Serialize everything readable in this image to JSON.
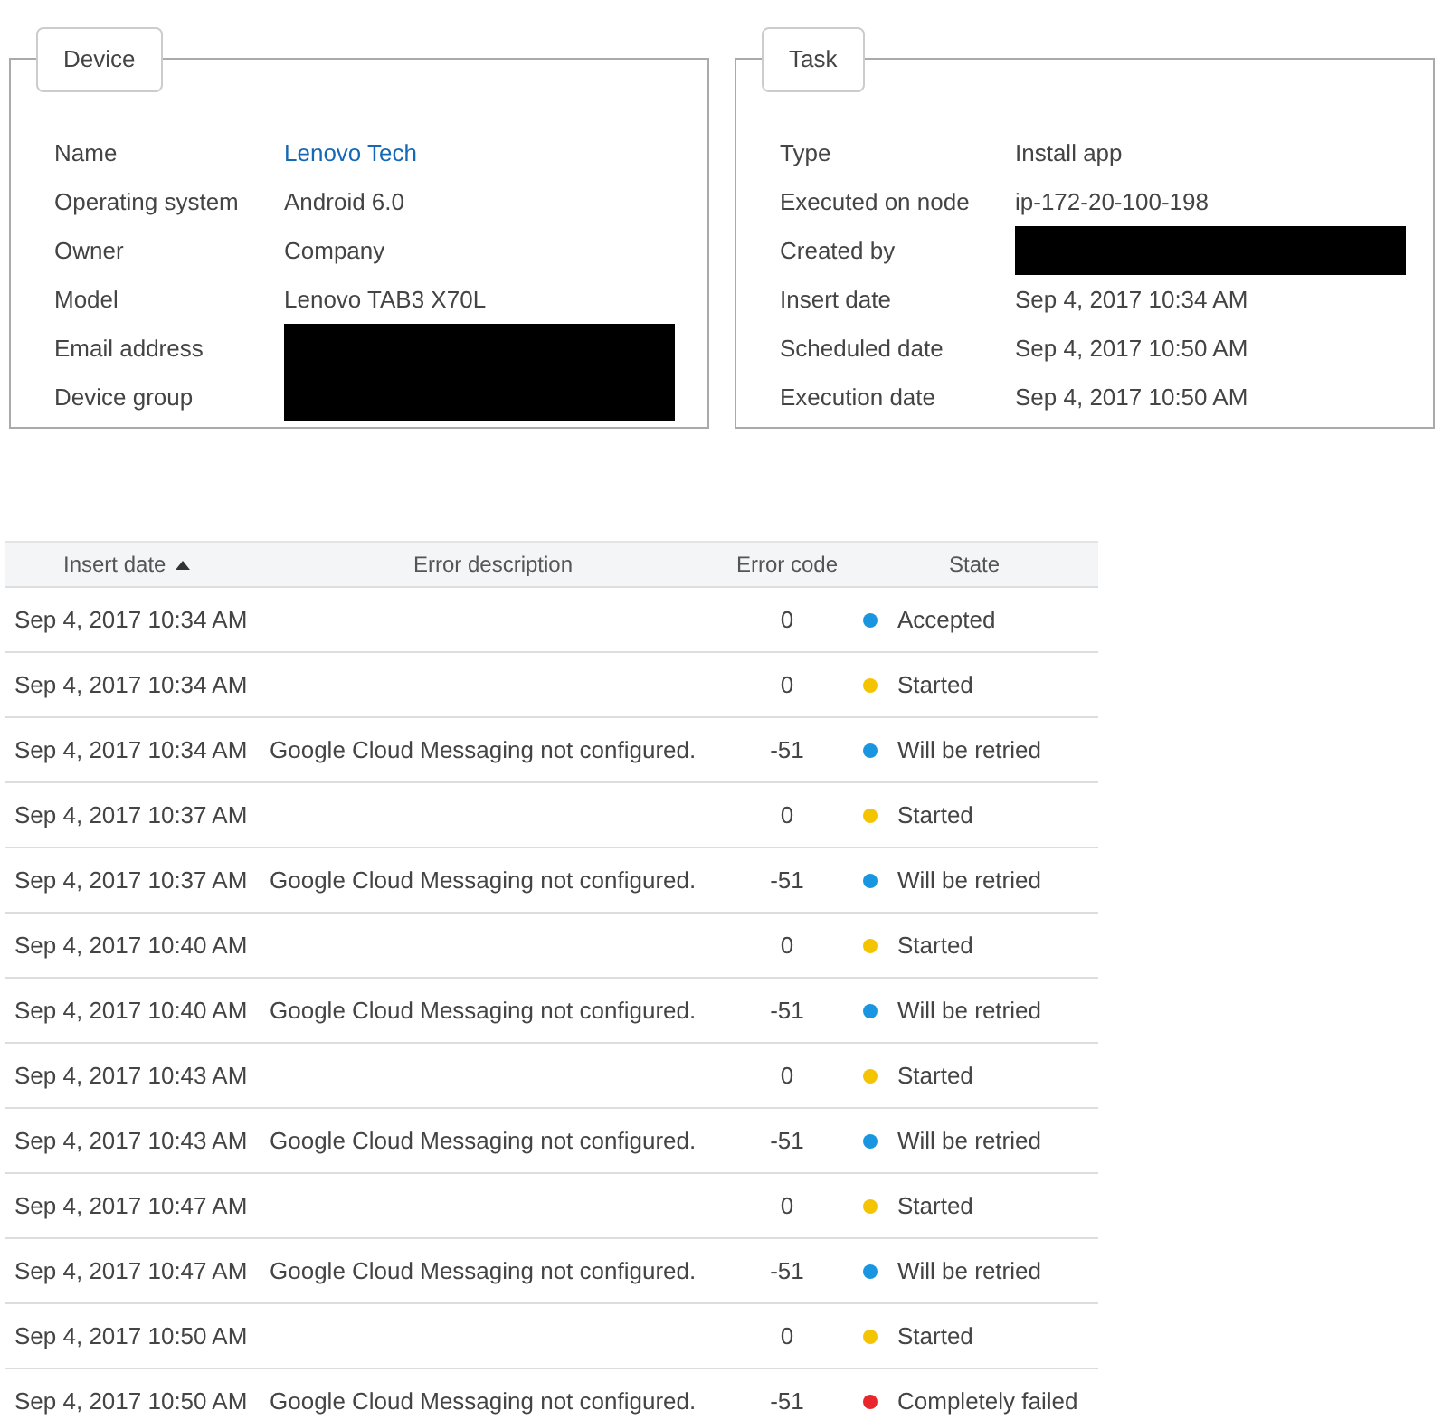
{
  "panels": [
    {
      "title": "Device",
      "fields": [
        {
          "label": "Name",
          "value": "Lenovo Tech",
          "link": true
        },
        {
          "label": "Operating system",
          "value": "Android 6.0"
        },
        {
          "label": "Owner",
          "value": "Company"
        },
        {
          "label": "Model",
          "value": "Lenovo TAB3 X70L"
        },
        {
          "label": "Email address",
          "redacted": true
        },
        {
          "label": "Device group",
          "redacted": true
        }
      ]
    },
    {
      "title": "Task",
      "fields": [
        {
          "label": "Type",
          "value": "Install app"
        },
        {
          "label": "Executed on node",
          "value": "ip-172-20-100-198"
        },
        {
          "label": "Created by",
          "redacted": true
        },
        {
          "label": "Insert date",
          "value": "Sep 4, 2017 10:34 AM"
        },
        {
          "label": "Scheduled date",
          "value": "Sep 4, 2017 10:50 AM"
        },
        {
          "label": "Execution date",
          "value": "Sep 4, 2017 10:50 AM"
        }
      ]
    }
  ],
  "table": {
    "columns": [
      {
        "label": "Insert date",
        "sorted": true
      },
      {
        "label": "Error description",
        "sorted": false
      },
      {
        "label": "Error code",
        "sorted": false
      },
      {
        "label": "State",
        "sorted": false
      }
    ],
    "rows": [
      {
        "insert_date": "Sep 4, 2017 10:34 AM",
        "error_code": "0",
        "state": "Accepted",
        "color": "#1a96e0"
      },
      {
        "insert_date": "Sep 4, 2017 10:34 AM",
        "error_code": "0",
        "state": "Started",
        "color": "#f5c400"
      },
      {
        "insert_date": "Sep 4, 2017 10:34 AM",
        "error_description": "Google Cloud Messaging not configured.",
        "error_code": "-51",
        "state": "Will be retried",
        "color": "#1a96e0"
      },
      {
        "insert_date": "Sep 4, 2017 10:37 AM",
        "error_code": "0",
        "state": "Started",
        "color": "#f5c400"
      },
      {
        "insert_date": "Sep 4, 2017 10:37 AM",
        "error_description": "Google Cloud Messaging not configured.",
        "error_code": "-51",
        "state": "Will be retried",
        "color": "#1a96e0"
      },
      {
        "insert_date": "Sep 4, 2017 10:40 AM",
        "error_code": "0",
        "state": "Started",
        "color": "#f5c400"
      },
      {
        "insert_date": "Sep 4, 2017 10:40 AM",
        "error_description": "Google Cloud Messaging not configured.",
        "error_code": "-51",
        "state": "Will be retried",
        "color": "#1a96e0"
      },
      {
        "insert_date": "Sep 4, 2017 10:43 AM",
        "error_code": "0",
        "state": "Started",
        "color": "#f5c400"
      },
      {
        "insert_date": "Sep 4, 2017 10:43 AM",
        "error_description": "Google Cloud Messaging not configured.",
        "error_code": "-51",
        "state": "Will be retried",
        "color": "#1a96e0"
      },
      {
        "insert_date": "Sep 4, 2017 10:47 AM",
        "error_code": "0",
        "state": "Started",
        "color": "#f5c400"
      },
      {
        "insert_date": "Sep 4, 2017 10:47 AM",
        "error_description": "Google Cloud Messaging not configured.",
        "error_code": "-51",
        "state": "Will be retried",
        "color": "#1a96e0"
      },
      {
        "insert_date": "Sep 4, 2017 10:50 AM",
        "error_code": "0",
        "state": "Started",
        "color": "#f5c400"
      },
      {
        "insert_date": "Sep 4, 2017 10:50 AM",
        "error_description": "Google Cloud Messaging not configured.",
        "error_code": "-51",
        "state": "Completely failed",
        "color": "#e8262b"
      }
    ]
  }
}
